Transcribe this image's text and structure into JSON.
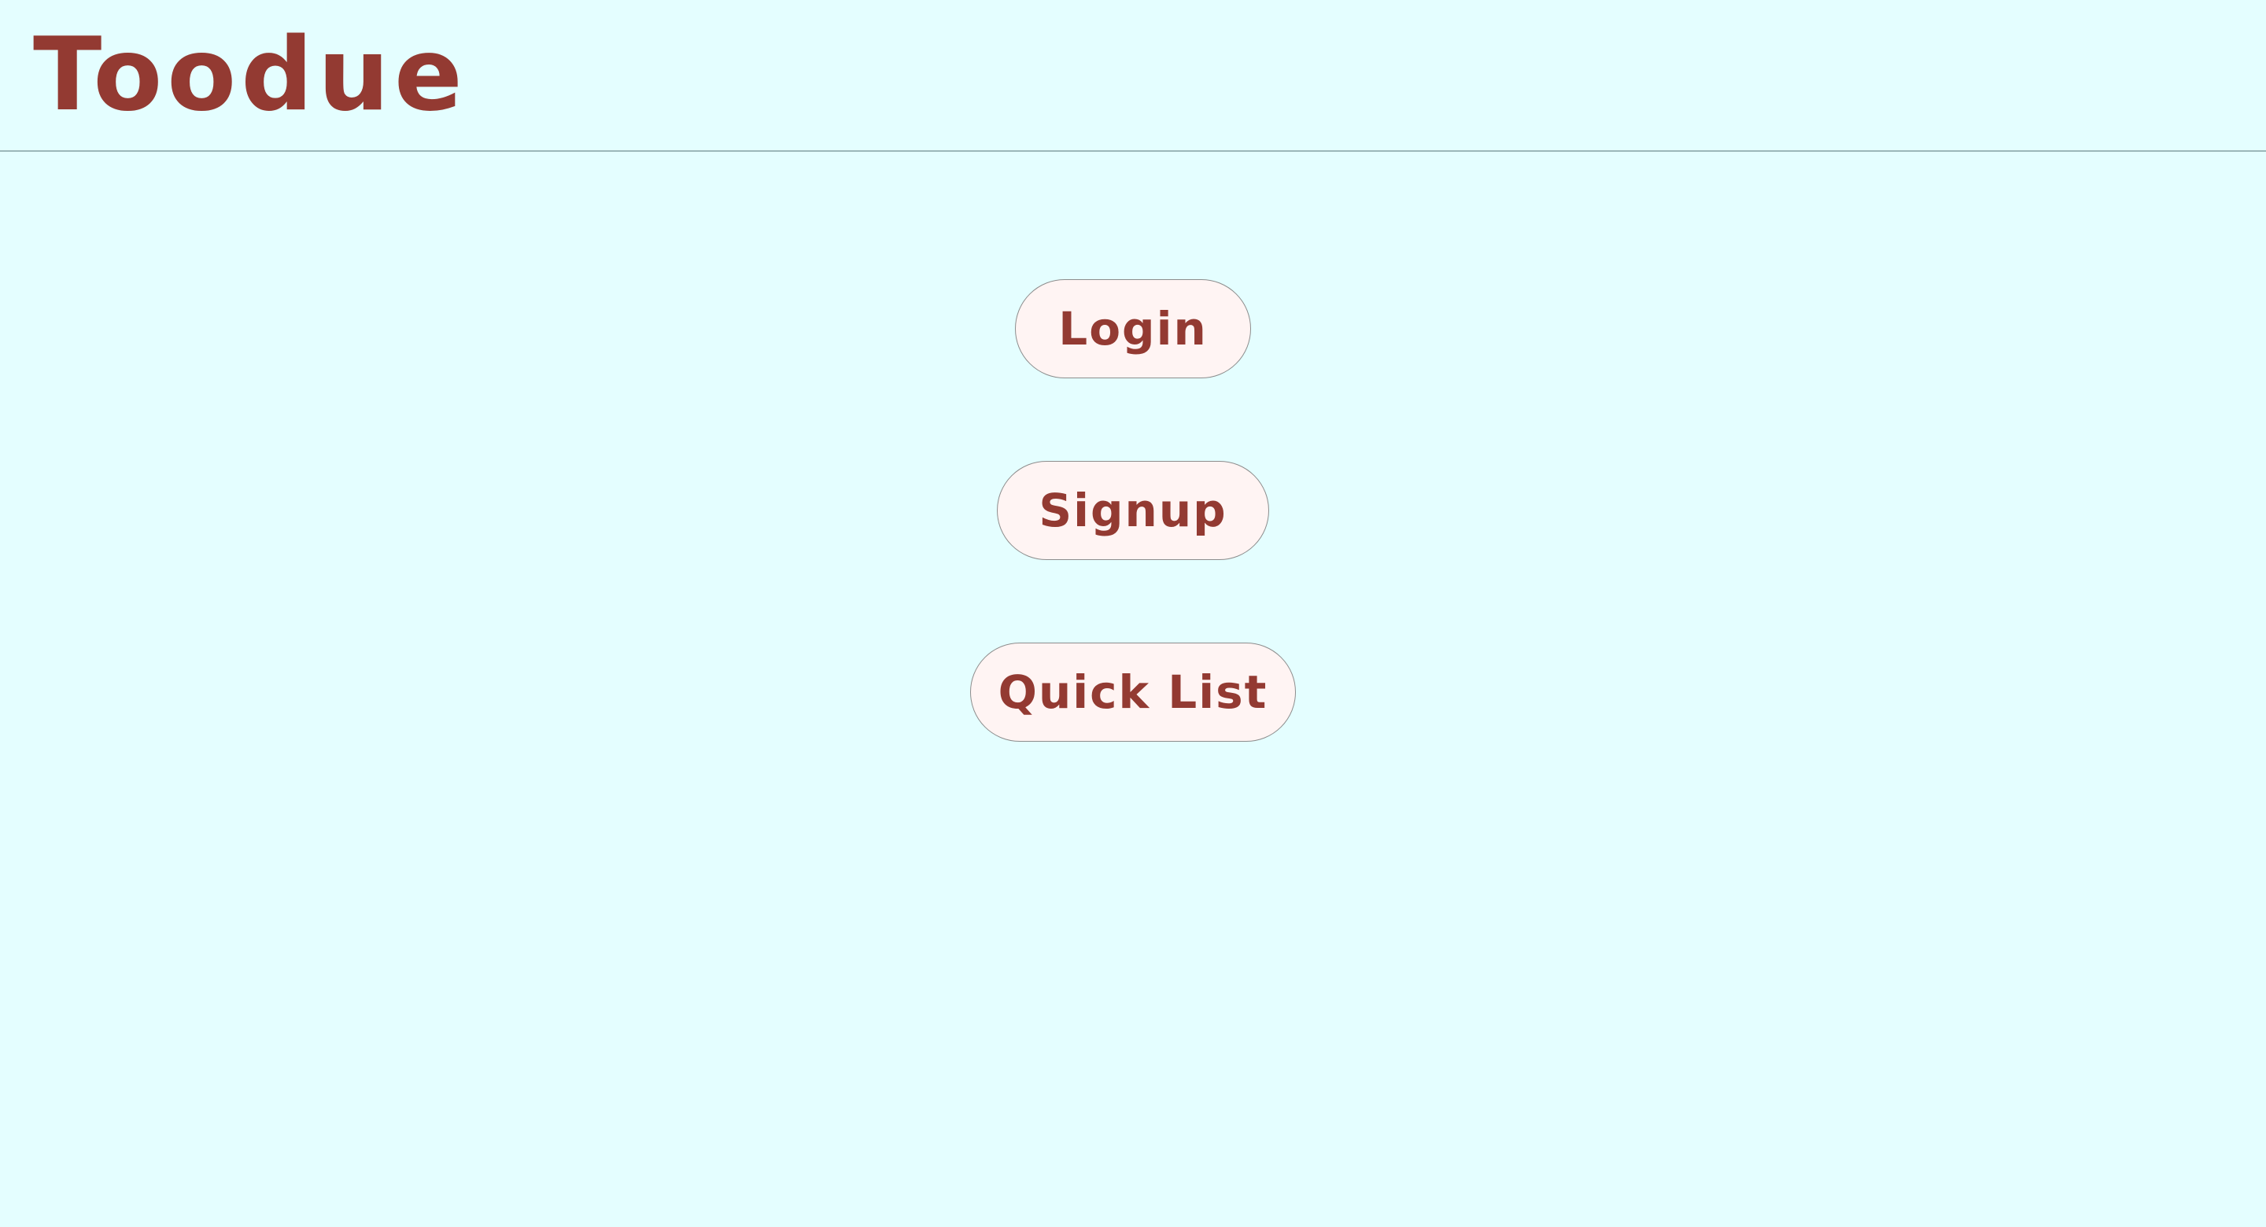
{
  "header": {
    "logo_text": "Toodue"
  },
  "menu": {
    "login_label": "Login",
    "signup_label": "Signup",
    "quick_list_label": "Quick List"
  },
  "colors": {
    "background": "#e4feff",
    "brand": "#933a32",
    "button_fill": "#fff4f3",
    "button_border": "#8c8c8c",
    "divider": "#9bb7b9"
  }
}
